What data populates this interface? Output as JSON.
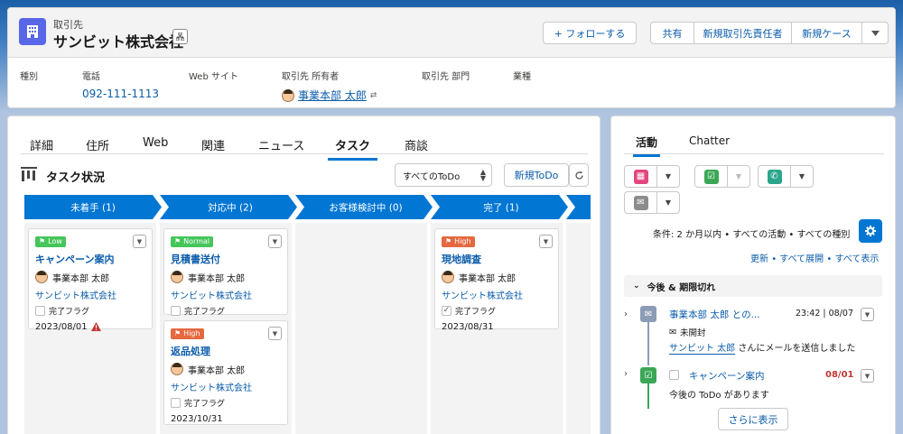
{
  "header": {
    "object_type": "取引先",
    "account_name": "サンビット株式会社",
    "follow_label": "+ フォローする",
    "actions": [
      "共有",
      "新規取引先責任者",
      "新規ケース"
    ],
    "fields": [
      {
        "label": "種別",
        "value": ""
      },
      {
        "label": "電話",
        "value": "092-111-1113"
      },
      {
        "label": "Web サイト",
        "value": ""
      },
      {
        "label": "取引先 所有者",
        "value": "事業本部 太郎"
      },
      {
        "label": "取引先 部門",
        "value": ""
      },
      {
        "label": "業種",
        "value": ""
      }
    ]
  },
  "main": {
    "tabs": [
      "詳細",
      "住所",
      "Web",
      "関連",
      "ニュース",
      "タスク",
      "商談"
    ],
    "active_tab": "タスク",
    "kanban_title": "タスク状況",
    "filter_value": "すべてのToDo",
    "new_todo_label": "新規ToDo",
    "stages": [
      "未着手 (1)",
      "対応中 (2)",
      "お客様検討中 (0)",
      "完了 (1)"
    ],
    "columns": [
      {
        "tasks": [
          {
            "priority": "Low",
            "title": "キャンペーン案内",
            "owner": "事業本部 太郎",
            "account": "サンビット株式会社",
            "flag_label": "完了フラグ",
            "flag_checked": false,
            "date": "2023/08/01",
            "overdue": true
          }
        ]
      },
      {
        "tasks": [
          {
            "priority": "Normal",
            "title": "見積書送付",
            "owner": "事業本部 太郎",
            "account": "サンビット株式会社",
            "flag_label": "完了フラグ",
            "flag_checked": false,
            "date": "",
            "overdue": false
          },
          {
            "priority": "High",
            "title": "返品処理",
            "owner": "事業本部 太郎",
            "account": "サンビット株式会社",
            "flag_label": "完了フラグ",
            "flag_checked": false,
            "date": "2023/10/31",
            "overdue": false
          }
        ]
      },
      {
        "tasks": []
      },
      {
        "tasks": [
          {
            "priority": "High",
            "title": "現地調査",
            "owner": "事業本部 太郎",
            "account": "サンビット株式会社",
            "flag_label": "完了フラグ",
            "flag_checked": true,
            "date": "2023/08/31",
            "overdue": false
          }
        ]
      }
    ]
  },
  "activity": {
    "tabs": [
      "活動",
      "Chatter"
    ],
    "active_tab": "活動",
    "filter_text": "条件: 2 か月以内 • すべての活動 • すべての種別",
    "links": [
      "更新",
      "すべて展開",
      "すべて表示"
    ],
    "section_title": "今後 & 期限切れ",
    "items": [
      {
        "type": "email",
        "title": "事業本部 太郎 との...",
        "meta": "23:42 | 08/07",
        "status": "未開封",
        "account_link": "サンビット 太郎",
        "detail": "さんにメールを送信しました"
      },
      {
        "type": "task",
        "title": "キャンペーン案内",
        "meta": "08/01",
        "detail": "今後の ToDo があります"
      }
    ],
    "more_label": "さらに表示"
  },
  "colors": {
    "brand": "#0176d3",
    "link": "#0b5cab",
    "account_icon": "#5867e8",
    "low_normal": "#45c65a",
    "high": "#e5683f",
    "overdue": "#c23934"
  }
}
